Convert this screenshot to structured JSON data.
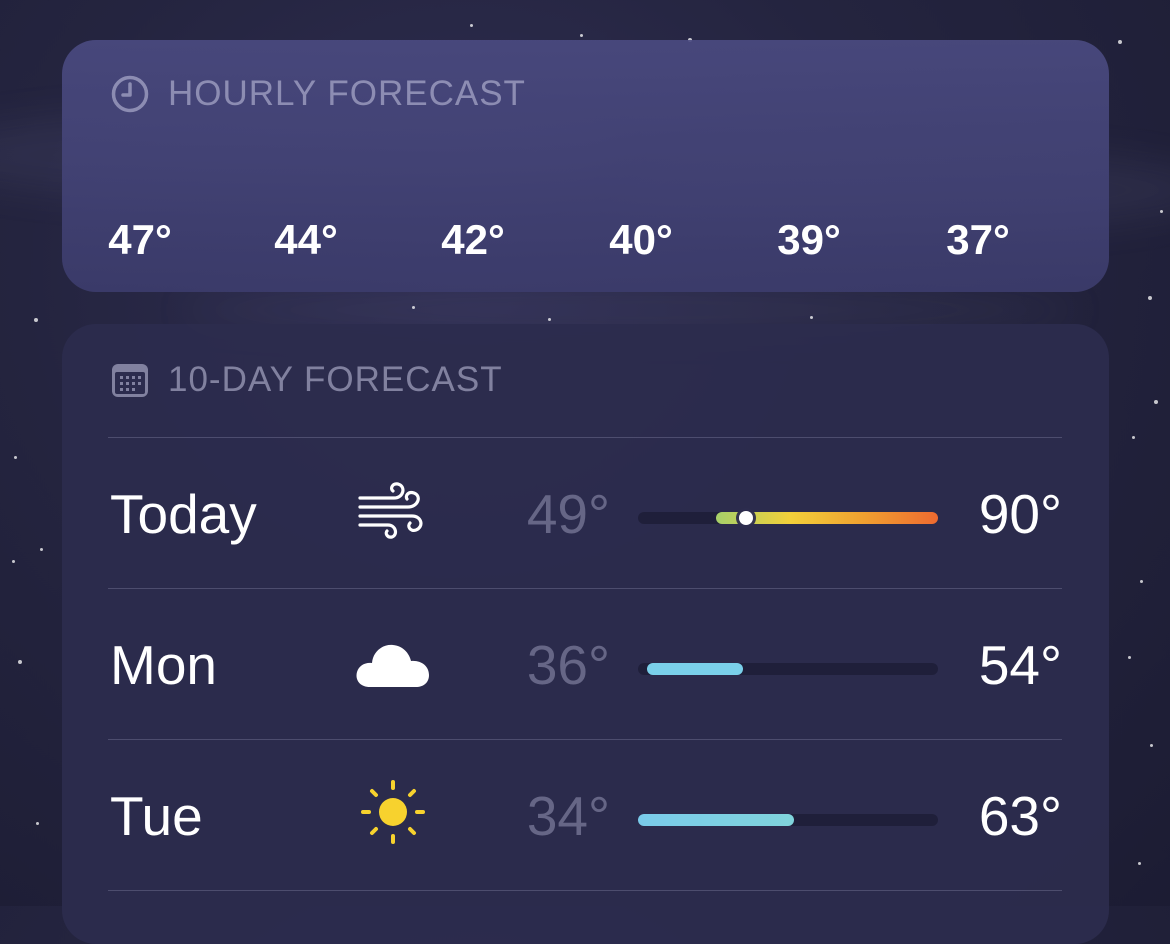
{
  "hourly_forecast": {
    "header": "HOURLY FORECAST",
    "header_icon": "clock-icon",
    "temps": [
      "47°",
      "44°",
      "42°",
      "40°",
      "39°",
      "37°"
    ]
  },
  "ten_day_forecast": {
    "header": "10-DAY FORECAST",
    "header_icon": "calendar-icon",
    "days": [
      {
        "name": "Today",
        "icon": "wind-icon",
        "low": "49°",
        "high": "90°",
        "range_start_fraction": 0.26,
        "range_end_fraction": 1.0,
        "current_fraction": 0.36,
        "gradient": [
          "#a6d06a",
          "#f2d03a",
          "#f0a030",
          "#ee6a30"
        ]
      },
      {
        "name": "Mon",
        "icon": "cloud-icon",
        "low": "36°",
        "high": "54°",
        "range_start_fraction": 0.03,
        "range_end_fraction": 0.35,
        "gradient": [
          "#7ad0ea",
          "#7ad0ea"
        ]
      },
      {
        "name": "Tue",
        "icon": "sun-icon",
        "low": "34°",
        "high": "63°",
        "range_start_fraction": 0.0,
        "range_end_fraction": 0.52,
        "gradient": [
          "#7acbea",
          "#80d4dc"
        ]
      }
    ]
  },
  "colors": {
    "sun": "#f7d22e",
    "cool_bar": "#7ad0ea",
    "warm_bar_end": "#ee6a30"
  }
}
